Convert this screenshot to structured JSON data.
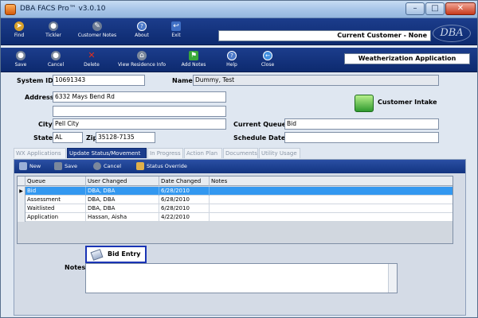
{
  "window": {
    "title": "DBA FACS Pro™ v3.0.10"
  },
  "toolbar_main": [
    {
      "label": "Find",
      "icon": "find-icon"
    },
    {
      "label": "Tickler",
      "icon": "tickler-icon"
    },
    {
      "label": "Customer Notes",
      "icon": "customer-notes-icon"
    },
    {
      "label": "About",
      "icon": "about-icon"
    },
    {
      "label": "Exit",
      "icon": "exit-icon"
    }
  ],
  "current_customer": "Current Customer - None",
  "logo_text": "DBA",
  "toolbar_record": [
    {
      "label": "Save",
      "icon": "save-icon"
    },
    {
      "label": "Cancel",
      "icon": "cancel-icon"
    },
    {
      "label": "Delete",
      "icon": "delete-icon"
    },
    {
      "label": "View Residence Info",
      "icon": "view-residence-icon"
    },
    {
      "label": "Add Notes",
      "icon": "add-notes-icon"
    },
    {
      "label": "Help",
      "icon": "help-icon"
    },
    {
      "label": "Close",
      "icon": "close-record-icon"
    }
  ],
  "section_title": "Weatherization Application",
  "form": {
    "system_id_label": "System ID",
    "system_id": "10691343",
    "name_label": "Name",
    "name": "Dummy, Test",
    "address_label": "Address",
    "address1": "6332 Mays Bend Rd",
    "address2": "",
    "city_label": "City",
    "city": "Pell City",
    "state_label": "State",
    "state": "AL",
    "zip_label": "Zip",
    "zip": "35128-7135",
    "current_queue_label": "Current Queue",
    "current_queue": "Bid",
    "schedule_date_label": "Schedule Date",
    "schedule_date": ""
  },
  "customer_intake_label": "Customer Intake",
  "tabs": [
    {
      "label": "WX Applications",
      "active": false
    },
    {
      "label": "Update Status/Movement",
      "active": true
    },
    {
      "label": "In Progress",
      "active": false
    },
    {
      "label": "Action Plan",
      "active": false
    },
    {
      "label": "Documents",
      "active": false
    },
    {
      "label": "Utility Usage",
      "active": false
    }
  ],
  "subtoolbar": [
    {
      "label": "New",
      "icon": "new-icon"
    },
    {
      "label": "Save",
      "icon": "save-icon"
    },
    {
      "label": "Cancel",
      "icon": "cancel-icon"
    },
    {
      "label": "Status Override",
      "icon": "status-override-icon"
    }
  ],
  "grid": {
    "columns": [
      "Queue",
      "User Changed",
      "Date Changed",
      "Notes"
    ],
    "rows": [
      {
        "queue": "Bid",
        "user": "DBA, DBA",
        "date": "6/28/2010",
        "notes": "",
        "selected": true
      },
      {
        "queue": "Assessment",
        "user": "DBA, DBA",
        "date": "6/28/2010",
        "notes": "",
        "selected": false
      },
      {
        "queue": "Waitlisted",
        "user": "DBA, DBA",
        "date": "6/28/2010",
        "notes": "",
        "selected": false
      },
      {
        "queue": "Application",
        "user": "Hassan, Aisha",
        "date": "4/22/2010",
        "notes": "",
        "selected": false
      }
    ]
  },
  "bid_entry_label": "Bid Entry",
  "notes_label": "Notes"
}
